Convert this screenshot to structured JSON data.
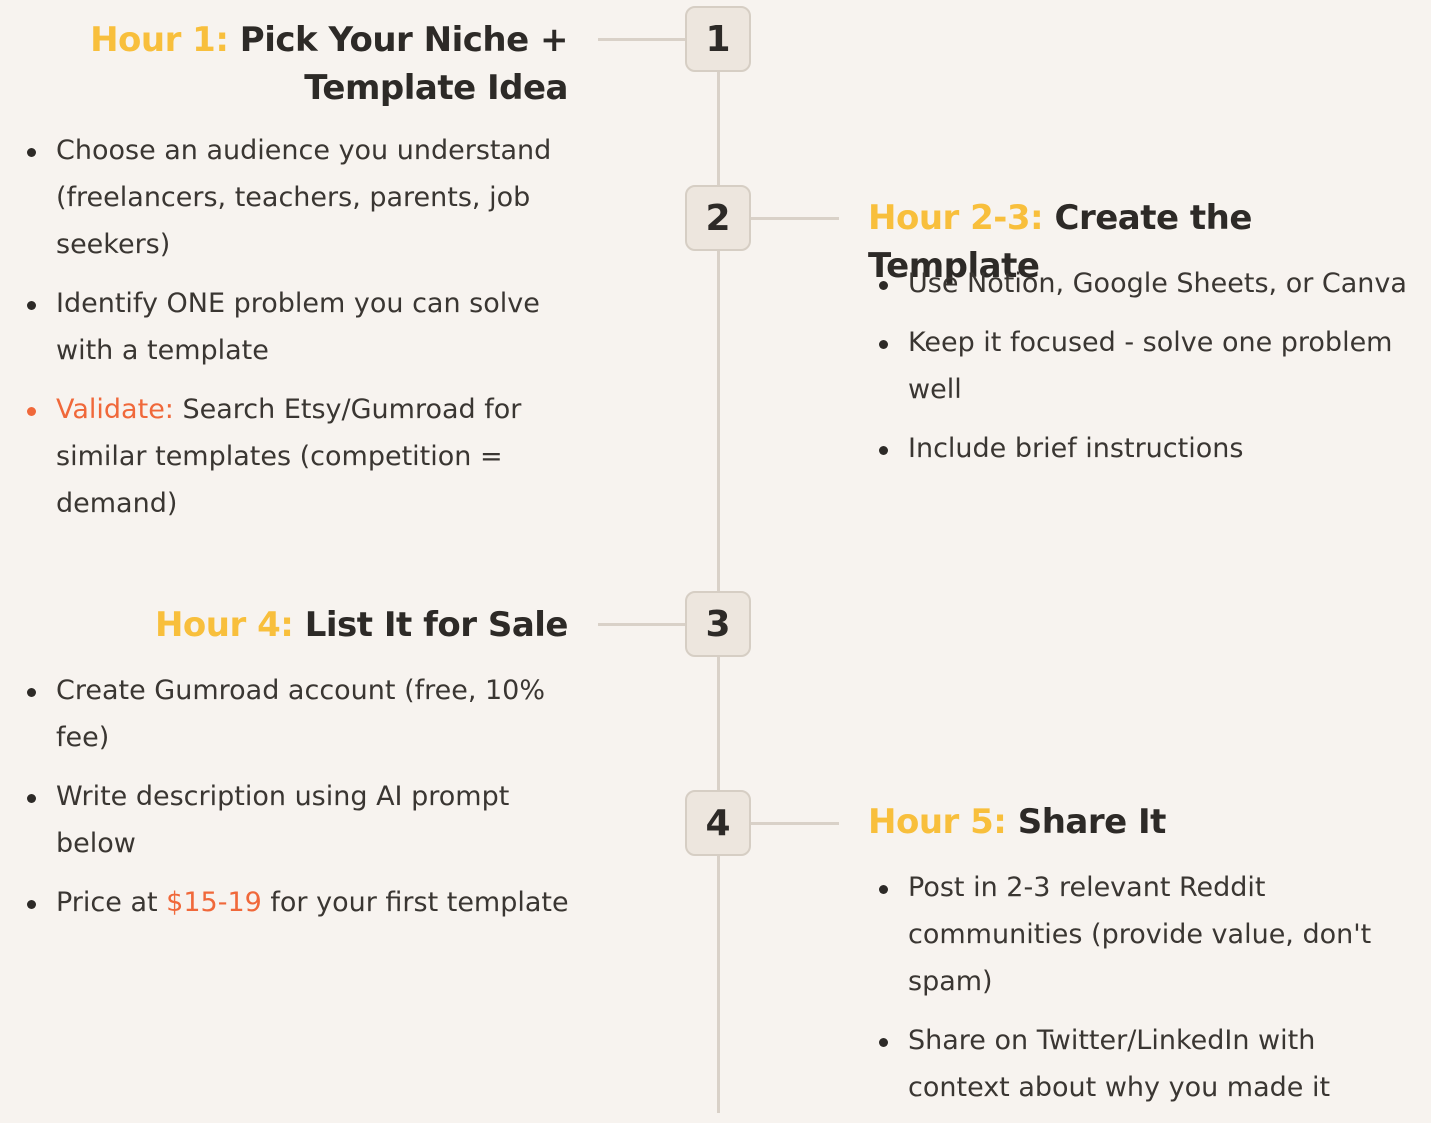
{
  "timeline": [
    {
      "number": "1",
      "hour": "Hour 1:",
      "title_line1": "Pick Your Niche +",
      "title_line2": "Template Idea",
      "bullets": [
        {
          "text": "Choose an audience you understand (freelancers, teachers, parents, job seekers)"
        },
        {
          "text": "Identify ONE problem you can solve with a template"
        },
        {
          "prefix": "Validate:",
          "text": " Search Etsy/Gumroad for similar templates (competition = demand)"
        }
      ]
    },
    {
      "number": "2",
      "hour": "Hour 2-3:",
      "title": "Create the Template",
      "bullets": [
        {
          "text": "Use Notion, Google Sheets, or Canva"
        },
        {
          "text": "Keep it focused - solve one problem well"
        },
        {
          "text": "Include brief instructions"
        }
      ]
    },
    {
      "number": "3",
      "hour": "Hour 4:",
      "title": "List It for Sale",
      "bullets": [
        {
          "text": "Create Gumroad account (free, 10% fee)"
        },
        {
          "text": "Write description using AI prompt below"
        },
        {
          "before": "Price at ",
          "highlight": "$15-19",
          "after": " for your first template"
        }
      ]
    },
    {
      "number": "4",
      "hour": "Hour 5:",
      "title": "Share It",
      "bullets": [
        {
          "text": "Post in 2-3 relevant Reddit communities (provide value, don't spam)"
        },
        {
          "text": "Share on Twitter/LinkedIn with context about why you made it"
        }
      ]
    }
  ],
  "colors": {
    "background": "#f7f3ef",
    "hour_label": "#f8bf3c",
    "accent": "#f0683a",
    "line": "#d9d1c8",
    "box_fill": "#ede6de",
    "text": "#2d2a27"
  }
}
